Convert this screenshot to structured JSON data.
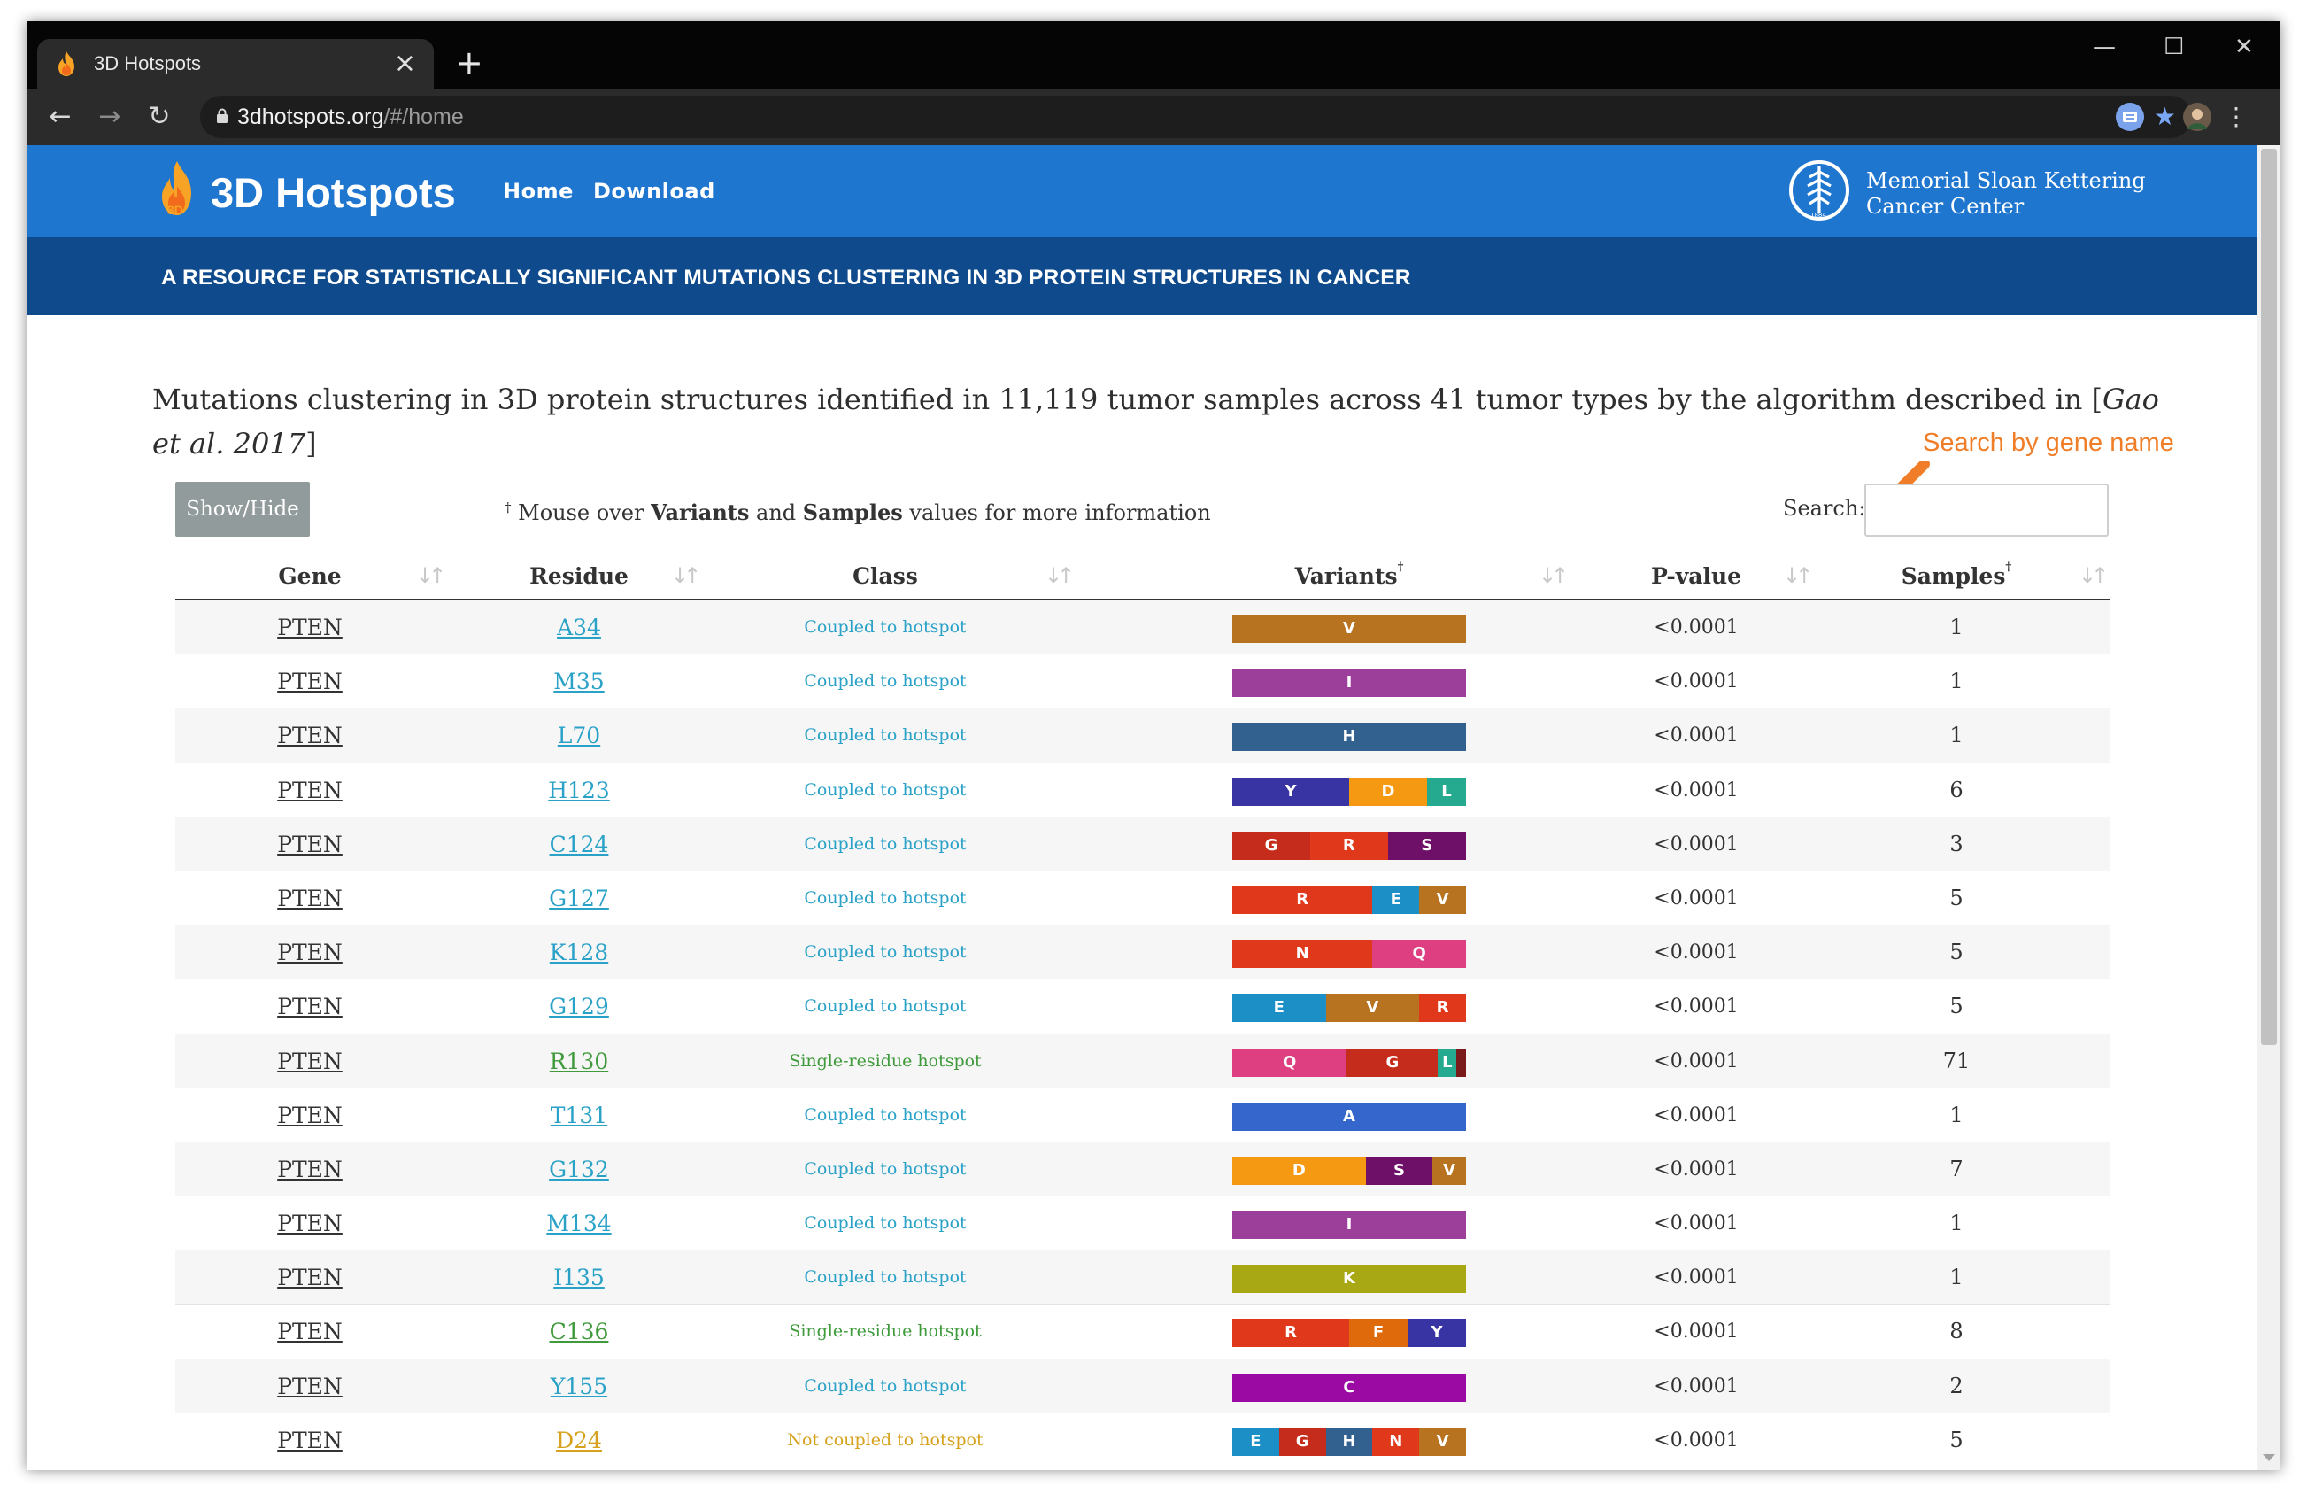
{
  "browser": {
    "tab_title": "3D Hotspots",
    "tab_close": "×",
    "new_tab": "+",
    "url_host": "3dhotspots.org",
    "url_path": "/#/home",
    "window_controls": {
      "minimize": "—",
      "maximize": "☐",
      "close": "✕"
    },
    "nav": {
      "back": "←",
      "forward": "→",
      "reload": "↻"
    },
    "bookmark_star": "★",
    "menu_dots": "⋮"
  },
  "site": {
    "title": "3D Hotspots",
    "nav": {
      "home": "Home",
      "download": "Download"
    },
    "partner_line1": "Memorial Sloan Kettering",
    "partner_line2": "Cancer Center",
    "banner": "A RESOURCE FOR STATISTICALLY SIGNIFICANT MUTATIONS CLUSTERING IN 3D PROTEIN STRUCTURES IN CANCER"
  },
  "intro": {
    "text_before": "Mutations clustering in 3D protein structures identified in 11,119 tumor samples across 41 tumor types by the algorithm described in [",
    "citation": "Gao et al. 2017",
    "text_after": "]"
  },
  "annotation": {
    "text": "Search by gene name",
    "color": "#f07d27"
  },
  "controls": {
    "show_hide": "Show/Hide",
    "note_dagger": "†",
    "note_pre": " Mouse over ",
    "note_variants": "Variants",
    "note_and": " and ",
    "note_samples": "Samples",
    "note_post": " values for more information",
    "search_label": "Search:",
    "search_value": ""
  },
  "table": {
    "headers": {
      "gene": "Gene",
      "residue": "Residue",
      "class": "Class",
      "variants": "Variants",
      "variants_mark": "†",
      "pvalue": "P-value",
      "samples": "Samples",
      "samples_mark": "†"
    },
    "sort_icon": "↓↑",
    "class_colors": {
      "Coupled to hotspot": "#2aa1c7",
      "Single-residue hotspot": "#3e9a3b",
      "Not coupled to hotspot": "#d6a21e"
    },
    "aa_colors": {
      "V": "#b87320",
      "I": "#9b3f9b",
      "H": "#33618f",
      "Y": "#3834a4",
      "D": "#f59812",
      "L": "#25a98f",
      "G": "#c62c1c",
      "R": "#e0381a",
      "S": "#6f1068",
      "E": "#1c8fc6",
      "N": "#e0381a",
      "Q": "#de3f80",
      "A": "#3566cc",
      "K": "#a8a814",
      "F": "#df6a0c",
      "C": "#9b0aa3",
      "X": "#7a1a1a"
    },
    "rows": [
      {
        "gene": "PTEN",
        "residue": "A34",
        "class": "Coupled to hotspot",
        "variants": [
          {
            "aa": "V",
            "frac": 1
          }
        ],
        "pvalue": "<0.0001",
        "samples": "1"
      },
      {
        "gene": "PTEN",
        "residue": "M35",
        "class": "Coupled to hotspot",
        "variants": [
          {
            "aa": "I",
            "frac": 1
          }
        ],
        "pvalue": "<0.0001",
        "samples": "1"
      },
      {
        "gene": "PTEN",
        "residue": "L70",
        "class": "Coupled to hotspot",
        "variants": [
          {
            "aa": "H",
            "frac": 1
          }
        ],
        "pvalue": "<0.0001",
        "samples": "1"
      },
      {
        "gene": "PTEN",
        "residue": "H123",
        "class": "Coupled to hotspot",
        "variants": [
          {
            "aa": "Y",
            "frac": 0.5
          },
          {
            "aa": "D",
            "frac": 0.333
          },
          {
            "aa": "L",
            "frac": 0.167
          }
        ],
        "pvalue": "<0.0001",
        "samples": "6"
      },
      {
        "gene": "PTEN",
        "residue": "C124",
        "class": "Coupled to hotspot",
        "variants": [
          {
            "aa": "G",
            "frac": 0.333
          },
          {
            "aa": "R",
            "frac": 0.333
          },
          {
            "aa": "S",
            "frac": 0.334
          }
        ],
        "pvalue": "<0.0001",
        "samples": "3"
      },
      {
        "gene": "PTEN",
        "residue": "G127",
        "class": "Coupled to hotspot",
        "variants": [
          {
            "aa": "R",
            "frac": 0.6
          },
          {
            "aa": "E",
            "frac": 0.2
          },
          {
            "aa": "V",
            "frac": 0.2
          }
        ],
        "pvalue": "<0.0001",
        "samples": "5"
      },
      {
        "gene": "PTEN",
        "residue": "K128",
        "class": "Coupled to hotspot",
        "variants": [
          {
            "aa": "N",
            "frac": 0.6
          },
          {
            "aa": "Q",
            "frac": 0.4
          }
        ],
        "pvalue": "<0.0001",
        "samples": "5"
      },
      {
        "gene": "PTEN",
        "residue": "G129",
        "class": "Coupled to hotspot",
        "variants": [
          {
            "aa": "E",
            "frac": 0.4
          },
          {
            "aa": "V",
            "frac": 0.4
          },
          {
            "aa": "R",
            "frac": 0.2
          }
        ],
        "pvalue": "<0.0001",
        "samples": "5"
      },
      {
        "gene": "PTEN",
        "residue": "R130",
        "class": "Single-residue hotspot",
        "variants": [
          {
            "aa": "Q",
            "frac": 0.49
          },
          {
            "aa": "G",
            "frac": 0.39
          },
          {
            "aa": "L",
            "frac": 0.08
          },
          {
            "aa": "X",
            "frac": 0.04
          }
        ],
        "pvalue": "<0.0001",
        "samples": "71"
      },
      {
        "gene": "PTEN",
        "residue": "T131",
        "class": "Coupled to hotspot",
        "variants": [
          {
            "aa": "A",
            "frac": 1
          }
        ],
        "pvalue": "<0.0001",
        "samples": "1"
      },
      {
        "gene": "PTEN",
        "residue": "G132",
        "class": "Coupled to hotspot",
        "variants": [
          {
            "aa": "D",
            "frac": 0.571
          },
          {
            "aa": "S",
            "frac": 0.286
          },
          {
            "aa": "V",
            "frac": 0.143
          }
        ],
        "pvalue": "<0.0001",
        "samples": "7"
      },
      {
        "gene": "PTEN",
        "residue": "M134",
        "class": "Coupled to hotspot",
        "variants": [
          {
            "aa": "I",
            "frac": 1
          }
        ],
        "pvalue": "<0.0001",
        "samples": "1"
      },
      {
        "gene": "PTEN",
        "residue": "I135",
        "class": "Coupled to hotspot",
        "variants": [
          {
            "aa": "K",
            "frac": 1
          }
        ],
        "pvalue": "<0.0001",
        "samples": "1"
      },
      {
        "gene": "PTEN",
        "residue": "C136",
        "class": "Single-residue hotspot",
        "variants": [
          {
            "aa": "R",
            "frac": 0.5
          },
          {
            "aa": "F",
            "frac": 0.25
          },
          {
            "aa": "Y",
            "frac": 0.25
          }
        ],
        "pvalue": "<0.0001",
        "samples": "8"
      },
      {
        "gene": "PTEN",
        "residue": "Y155",
        "class": "Coupled to hotspot",
        "variants": [
          {
            "aa": "C",
            "frac": 1
          }
        ],
        "pvalue": "<0.0001",
        "samples": "2"
      },
      {
        "gene": "PTEN",
        "residue": "D24",
        "class": "Not coupled to hotspot",
        "variants": [
          {
            "aa": "E",
            "frac": 0.2
          },
          {
            "aa": "G",
            "frac": 0.2
          },
          {
            "aa": "H",
            "frac": 0.2
          },
          {
            "aa": "N",
            "frac": 0.2
          },
          {
            "aa": "V",
            "frac": 0.2
          }
        ],
        "pvalue": "<0.0001",
        "samples": "5"
      }
    ]
  }
}
